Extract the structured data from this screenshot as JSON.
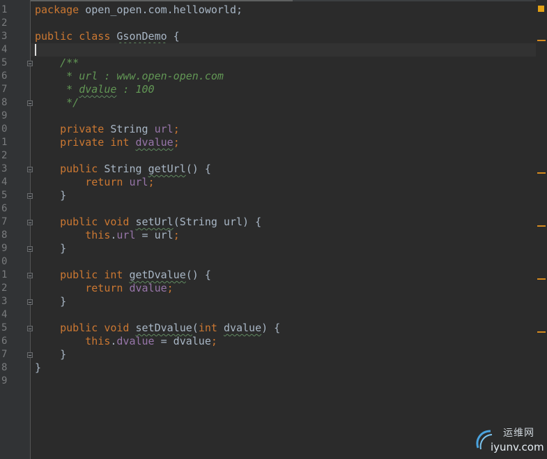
{
  "editor": {
    "line_numbers": [
      "1",
      "2",
      "3",
      "4",
      "5",
      "6",
      "7",
      "8",
      "9",
      "0",
      "1",
      "2",
      "3",
      "4",
      "5",
      "6",
      "7",
      "8",
      "9",
      "0",
      "1",
      "2",
      "3",
      "4",
      "5",
      "6",
      "7",
      "8",
      "9"
    ],
    "lines": [
      [
        {
          "t": "package ",
          "c": "kw"
        },
        {
          "t": "open_open.com.helloworld;",
          "c": ""
        }
      ],
      [],
      [
        {
          "t": "public class ",
          "c": "kw"
        },
        {
          "t": "GsonDemo",
          "c": "typo"
        },
        {
          "t": " {",
          "c": ""
        }
      ],
      [],
      [
        {
          "t": "    /**",
          "c": "cm"
        }
      ],
      [
        {
          "t": "     * url : www.open-open.com",
          "c": "cm"
        }
      ],
      [
        {
          "t": "     * ",
          "c": "cm"
        },
        {
          "t": "dvalue",
          "c": "cm typo"
        },
        {
          "t": " : 100",
          "c": "cm"
        }
      ],
      [
        {
          "t": "     */",
          "c": "cm"
        }
      ],
      [],
      [
        {
          "t": "    private ",
          "c": "kw"
        },
        {
          "t": "String ",
          "c": ""
        },
        {
          "t": "url",
          "c": "fld"
        },
        {
          "t": ";",
          "c": "kw"
        }
      ],
      [
        {
          "t": "    private int ",
          "c": "kw"
        },
        {
          "t": "dvalue",
          "c": "fld typo"
        },
        {
          "t": ";",
          "c": "kw"
        }
      ],
      [],
      [
        {
          "t": "    public ",
          "c": "kw"
        },
        {
          "t": "String ",
          "c": ""
        },
        {
          "t": "getUrl",
          "c": "typo"
        },
        {
          "t": "() {",
          "c": ""
        }
      ],
      [
        {
          "t": "        return ",
          "c": "kw"
        },
        {
          "t": "url",
          "c": "fld"
        },
        {
          "t": ";",
          "c": "kw"
        }
      ],
      [
        {
          "t": "    }",
          "c": ""
        }
      ],
      [],
      [
        {
          "t": "    public void ",
          "c": "kw"
        },
        {
          "t": "setUrl",
          "c": "typo"
        },
        {
          "t": "(String url) {",
          "c": ""
        }
      ],
      [
        {
          "t": "        this",
          "c": "kw"
        },
        {
          "t": ".",
          "c": ""
        },
        {
          "t": "url",
          "c": "fld"
        },
        {
          "t": " = url",
          "c": ""
        },
        {
          "t": ";",
          "c": "kw"
        }
      ],
      [
        {
          "t": "    }",
          "c": ""
        }
      ],
      [],
      [
        {
          "t": "    public int ",
          "c": "kw"
        },
        {
          "t": "getDvalue",
          "c": "typo"
        },
        {
          "t": "() {",
          "c": ""
        }
      ],
      [
        {
          "t": "        return ",
          "c": "kw"
        },
        {
          "t": "dvalue",
          "c": "fld"
        },
        {
          "t": ";",
          "c": "kw"
        }
      ],
      [
        {
          "t": "    }",
          "c": ""
        }
      ],
      [],
      [
        {
          "t": "    public void ",
          "c": "kw"
        },
        {
          "t": "setDvalue",
          "c": "typo"
        },
        {
          "t": "(",
          "c": ""
        },
        {
          "t": "int ",
          "c": "kw"
        },
        {
          "t": "dvalue",
          "c": "typo"
        },
        {
          "t": ") {",
          "c": ""
        }
      ],
      [
        {
          "t": "        this",
          "c": "kw"
        },
        {
          "t": ".",
          "c": ""
        },
        {
          "t": "dvalue",
          "c": "fld"
        },
        {
          "t": " = dvalue",
          "c": ""
        },
        {
          "t": ";",
          "c": "kw"
        }
      ],
      [
        {
          "t": "    }",
          "c": ""
        }
      ],
      [
        {
          "t": "}",
          "c": ""
        }
      ],
      []
    ],
    "current_line": 4,
    "fold_markers": [
      {
        "line": 5,
        "kind": "top"
      },
      {
        "line": 8,
        "kind": "bot"
      },
      {
        "line": 13,
        "kind": "top"
      },
      {
        "line": 15,
        "kind": "bot"
      },
      {
        "line": 17,
        "kind": "top"
      },
      {
        "line": 19,
        "kind": "bot"
      },
      {
        "line": 21,
        "kind": "top"
      },
      {
        "line": 23,
        "kind": "bot"
      },
      {
        "line": 25,
        "kind": "top"
      },
      {
        "line": 27,
        "kind": "bot"
      }
    ],
    "scroll_markers_lines": [
      3,
      13,
      17,
      21,
      25
    ]
  },
  "colors": {
    "background": "#2b2b2b",
    "keyword": "#cc7832",
    "comment": "#629755",
    "field": "#9876aa",
    "text": "#a9b7c6",
    "marker": "#d68a1e"
  },
  "watermark": {
    "cn": "运维网",
    "en": "iyunv.com"
  }
}
